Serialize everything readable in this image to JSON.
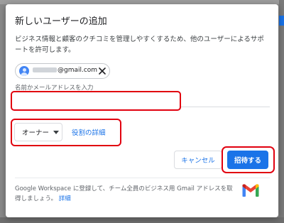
{
  "dialog": {
    "title": "新しいユーザーの追加",
    "description": "ビジネス情報と顧客のクチコミを管理しやすくするため、他のユーザーによるサポートを許可します。",
    "chip": {
      "email_domain": "@gmail.com",
      "avatar_icon": "person-avatar-icon",
      "close_icon": "close-icon"
    },
    "input": {
      "label": "名前かメールアドレスを入力",
      "value": ""
    },
    "role": {
      "selected": "オーナー",
      "details_link": "役割の詳細"
    },
    "buttons": {
      "cancel": "キャンセル",
      "invite": "招待する"
    },
    "footer": {
      "text": "Google Workspace に登録して、チーム全員のビジネス用 Gmail アドレスを取得しましょう。",
      "link": "詳細",
      "logo_icon": "gmail-logo-icon"
    }
  },
  "colors": {
    "accent": "#1a73e8",
    "highlight": "#e1000f",
    "overlay": "#8a8a8a"
  }
}
